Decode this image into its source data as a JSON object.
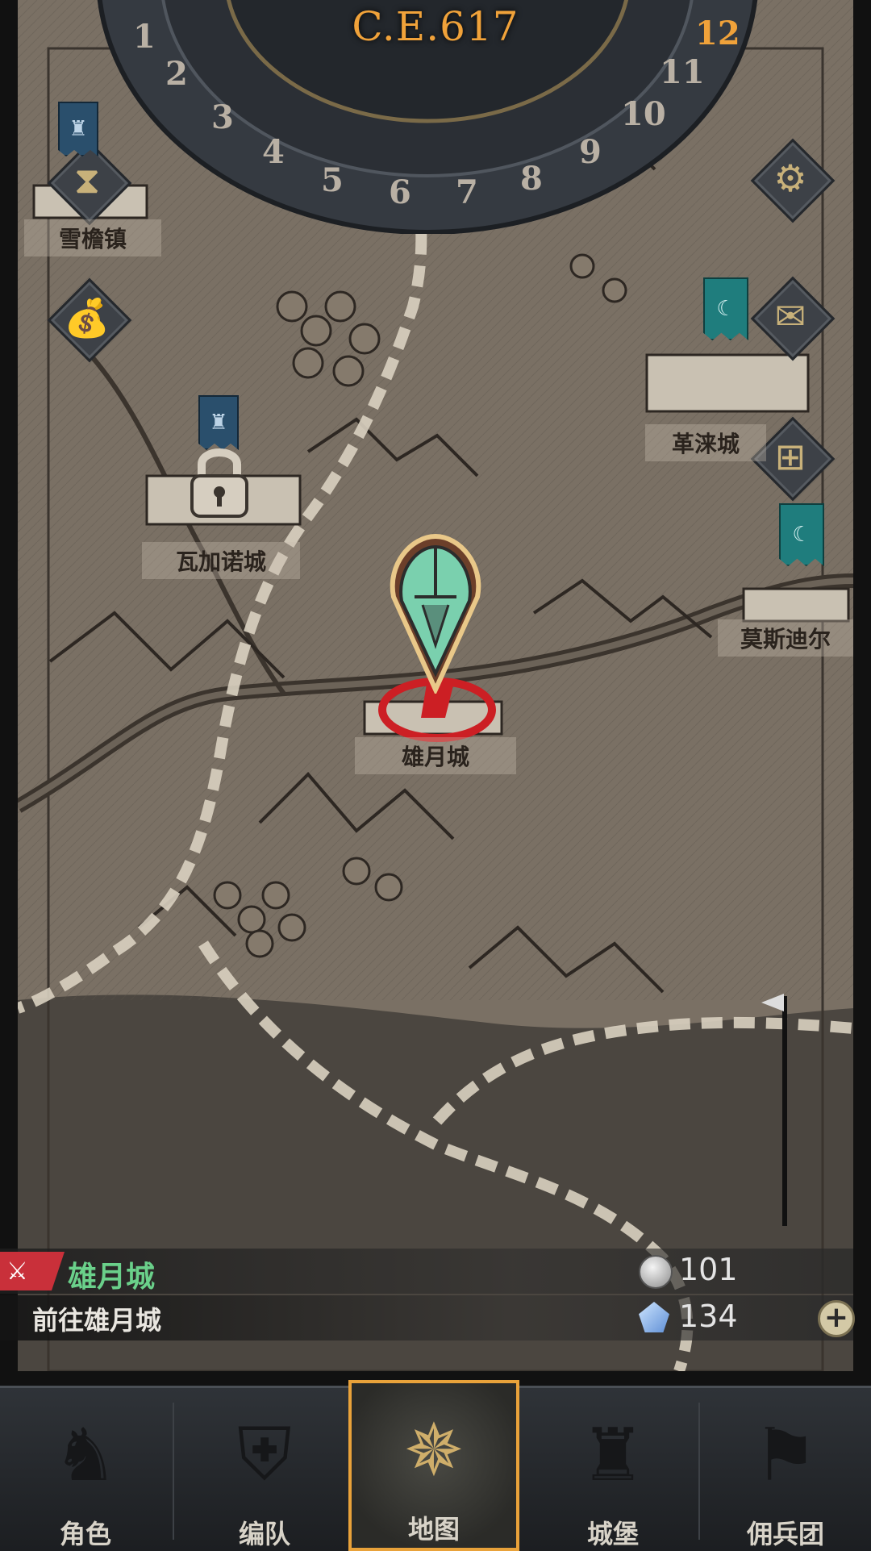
{
  "header": {
    "date": "C.E.617"
  },
  "calendar": {
    "months": [
      "1",
      "2",
      "3",
      "4",
      "5",
      "6",
      "7",
      "8",
      "9",
      "10",
      "11",
      "12"
    ],
    "current_month": "12"
  },
  "side_buttons": {
    "left": [
      {
        "icon": "hourglass-icon"
      },
      {
        "icon": "money-bag-icon"
      }
    ],
    "right": [
      {
        "icon": "gear-icon"
      },
      {
        "icon": "mail-icon"
      },
      {
        "icon": "window-icon"
      }
    ]
  },
  "towns": {
    "xuejian": "雪檐镇",
    "wajianuo": "瓦加诺城",
    "gelai": "革涞城",
    "mosidier": "莫斯迪尔",
    "xiongyue": "雄月城"
  },
  "quest": {
    "title": "雄月城",
    "description": "前往雄月城"
  },
  "resources": {
    "silver": "101",
    "crystal": "134"
  },
  "nav": {
    "tabs": [
      {
        "label": "角色",
        "icon": "knight-icon"
      },
      {
        "label": "编队",
        "icon": "helmet-icon"
      },
      {
        "label": "地图",
        "icon": "compass-icon"
      },
      {
        "label": "城堡",
        "icon": "castle-icon"
      },
      {
        "label": "佣兵团",
        "icon": "mercenary-icon"
      }
    ],
    "active": "地图"
  },
  "colors": {
    "date": "#f0a23a",
    "quest_title": "#6ad08a",
    "active_tab_border": "#e9a23a",
    "route_marker": "#cc1f24"
  }
}
